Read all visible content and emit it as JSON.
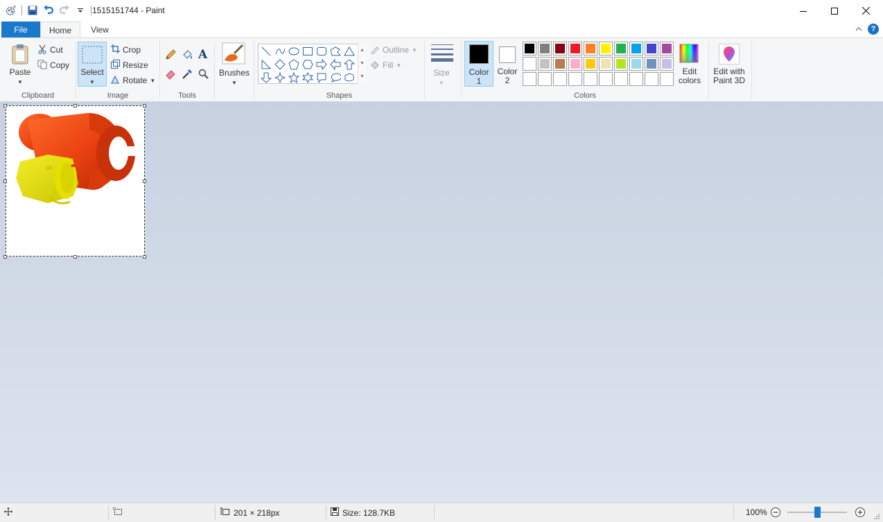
{
  "window": {
    "title": "1515151744 - Paint",
    "controls": {
      "minimize": "—",
      "maximize": "☐",
      "close": "✕"
    }
  },
  "tabs": {
    "file": "File",
    "home": "Home",
    "view": "View"
  },
  "ribbon": {
    "clipboard": {
      "label": "Clipboard",
      "paste": "Paste",
      "cut": "Cut",
      "copy": "Copy"
    },
    "image": {
      "label": "Image",
      "select": "Select",
      "crop": "Crop",
      "resize": "Resize",
      "rotate": "Rotate"
    },
    "tools": {
      "label": "Tools"
    },
    "brushes": {
      "label": "Brushes"
    },
    "shapes": {
      "label": "Shapes",
      "outline": "Outline",
      "fill": "Fill"
    },
    "size": {
      "label": "Size"
    },
    "colors": {
      "label": "Colors",
      "color1_line1": "Color",
      "color1_line2": "1",
      "color2_line1": "Color",
      "color2_line2": "2",
      "color1_value": "#000000",
      "color2_value": "#ffffff",
      "edit_colors_line1": "Edit",
      "edit_colors_line2": "colors",
      "palette_row1": [
        "#000000",
        "#7f7f7f",
        "#880015",
        "#ed1c24",
        "#ff7f27",
        "#fff200",
        "#22b14c",
        "#00a2e8",
        "#3f48cc",
        "#a349a4"
      ],
      "palette_row2": [
        "#ffffff",
        "#c3c3c3",
        "#b97a57",
        "#ffaec9",
        "#ffc90e",
        "#efe4b0",
        "#b5e61d",
        "#99d9ea",
        "#7092be",
        "#c8bfe7"
      ]
    },
    "paint3d": {
      "line1": "Edit with",
      "line2": "Paint 3D"
    }
  },
  "statusbar": {
    "dimensions": "201 × 218px",
    "size": "Size: 128.7KB",
    "zoom": "100%"
  },
  "icons": [
    "paint-app-icon",
    "save-icon",
    "undo-icon",
    "redo-icon",
    "customize-qat-icon",
    "help-icon",
    "collapse-ribbon-icon",
    "paste-icon",
    "cut-icon",
    "copy-icon",
    "crop-icon",
    "resize-icon",
    "rotate-icon",
    "pencil-icon",
    "fill-icon",
    "text-icon",
    "eraser-icon",
    "color-picker-icon",
    "magnifier-icon",
    "brushes-icon",
    "size-icon",
    "edit-colors-icon",
    "paint3d-icon",
    "move-cursor-icon",
    "selection-size-icon",
    "canvas-size-icon",
    "disk-icon",
    "zoom-out-icon",
    "zoom-in-icon",
    "resize-grip-icon"
  ]
}
